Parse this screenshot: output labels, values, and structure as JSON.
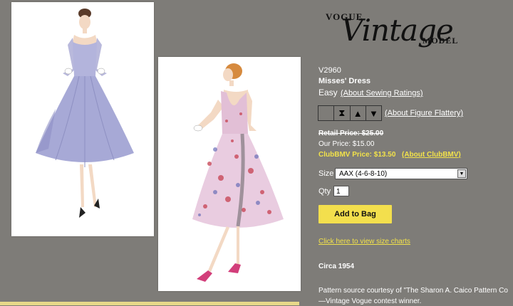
{
  "logo": {
    "vogue": "VOGUE",
    "script": "Vintage",
    "model": "MODEL"
  },
  "product": {
    "code": "V2960",
    "name": "Misses' Dress",
    "difficulty": "Easy",
    "sewing_ratings_link": "(About Sewing Ratings)",
    "figure_flattery_link": "(About Figure Flattery)",
    "retail_price": "Retail Price: $25.00",
    "our_price": "Our Price: $15.00",
    "club_price": "ClubBMV Price: $13.50",
    "club_link": "(About ClubBMV)",
    "size_label": "Size",
    "size_value": "AAX (4-6-8-10)",
    "qty_label": "Qty",
    "qty_value": "1",
    "add_to_bag": "Add to Bag",
    "size_chart_link": "Click here to view size charts",
    "circa": "Circa 1954",
    "source_line1": "Pattern source courtesy of \"The Sharon A. Caico Pattern Co",
    "source_line2": "—Vintage Vogue contest winner."
  },
  "figure_flattery_icons": [
    "empty-icon",
    "hourglass-icon",
    "triangle-up-icon",
    "triangle-down-icon"
  ],
  "colors": {
    "background": "#7e7c78",
    "accent_yellow": "#f3df4d",
    "link_yellow": "#f2e24a"
  }
}
